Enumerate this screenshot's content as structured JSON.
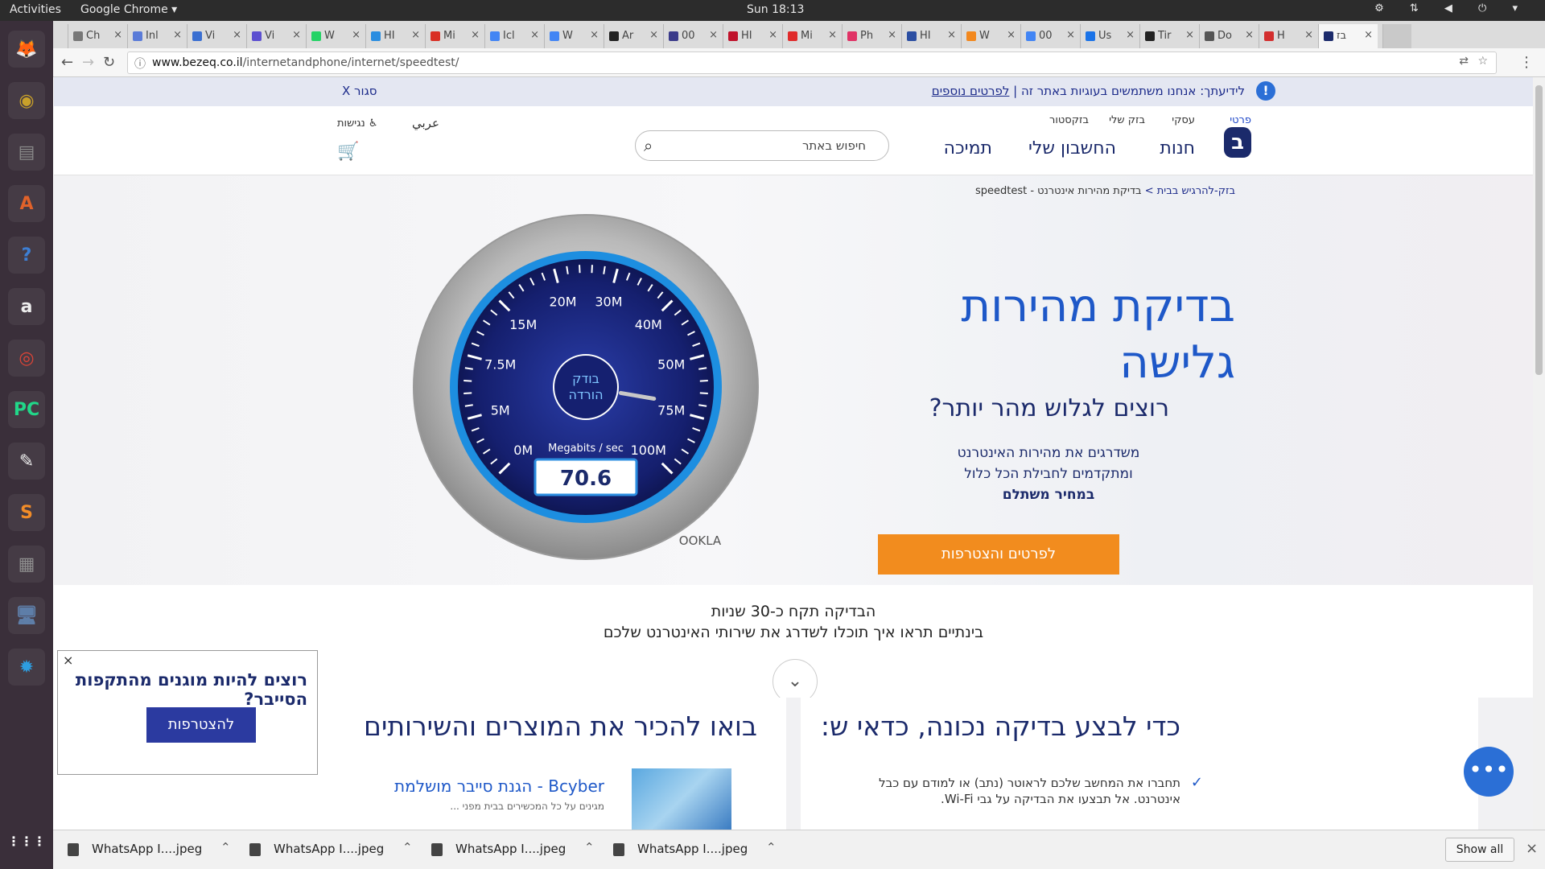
{
  "topbar": {
    "activities": "Activities",
    "app_name": "Google Chrome ▾",
    "clock": "Sun 18:13",
    "tray": "⚙ ⇅ ◀ ⏻ ▾"
  },
  "launcher": {
    "apps": [
      {
        "name": "firefox-icon",
        "glyph": "🦊",
        "color": "#e66000"
      },
      {
        "name": "rhythmbox-icon",
        "glyph": "◉",
        "color": "#c9a12a"
      },
      {
        "name": "files-icon",
        "glyph": "▤",
        "color": "#8a8a8a"
      },
      {
        "name": "software-center-icon",
        "glyph": "A",
        "color": "#e0622a"
      },
      {
        "name": "help-icon",
        "glyph": "?",
        "color": "#3d7fd4"
      },
      {
        "name": "amazon-icon",
        "glyph": "a",
        "color": "#ededed"
      },
      {
        "name": "chrome-icon",
        "glyph": "◎",
        "color": "#db4437"
      },
      {
        "name": "pycharm-icon",
        "glyph": "PC",
        "color": "#21d789"
      },
      {
        "name": "libreoffice-icon",
        "glyph": "✎",
        "color": "#eeeeee"
      },
      {
        "name": "sublime-icon",
        "glyph": "S",
        "color": "#f28c28"
      },
      {
        "name": "calculator-icon",
        "glyph": "▦",
        "color": "#8e8e8e"
      },
      {
        "name": "remote-desktop-icon",
        "glyph": "🖥",
        "color": "#5e7ea8"
      },
      {
        "name": "settings-icon",
        "glyph": "✹",
        "color": "#2d9de0"
      }
    ],
    "grid_glyph": "⋮⋮⋮"
  },
  "tabs": [
    {
      "label": "Ch",
      "favicon": "#777777"
    },
    {
      "label": "Inl",
      "favicon": "#5a7bd8"
    },
    {
      "label": "Vi",
      "favicon": "#3a6fd1"
    },
    {
      "label": "Vi",
      "favicon": "#5c4fd0"
    },
    {
      "label": "W",
      "favicon": "#25d366"
    },
    {
      "label": "HI",
      "favicon": "#2a8de0"
    },
    {
      "label": "Mi",
      "favicon": "#d93025"
    },
    {
      "label": "Icl",
      "favicon": "#4285f4"
    },
    {
      "label": "W",
      "favicon": "#4285f4"
    },
    {
      "label": "Ar",
      "favicon": "#222222"
    },
    {
      "label": "00",
      "favicon": "#3a3a8a"
    },
    {
      "label": "HI",
      "favicon": "#c0122b"
    },
    {
      "label": "Mi",
      "favicon": "#e02a2a"
    },
    {
      "label": "Ph",
      "favicon": "#e03366"
    },
    {
      "label": "HI",
      "favicon": "#2b4ea2"
    },
    {
      "label": "W",
      "favicon": "#f2881e"
    },
    {
      "label": "00",
      "favicon": "#4285f4"
    },
    {
      "label": "Us",
      "favicon": "#1a73e8"
    },
    {
      "label": "Tir",
      "favicon": "#222222"
    },
    {
      "label": "Do",
      "favicon": "#555555"
    },
    {
      "label": "H",
      "favicon": "#d32f2f"
    },
    {
      "label": "בז",
      "favicon": "#1b2a6b"
    }
  ],
  "address": {
    "domain": "www.bezeq.co.il",
    "path": "/internetandphone/internet/speedtest/",
    "back": "←",
    "forward": "→",
    "reload": "↻",
    "lock": "ⓘ",
    "translate": "⇄",
    "star": "☆",
    "menu": "⋮"
  },
  "cookie_bar": {
    "message": "לידיעתך: אנחנו משתמשים בעוגיות באתר זה | ",
    "link": "לפרטים נוספים",
    "close": "סגור X",
    "icon": "!"
  },
  "header": {
    "sections": [
      "פרטי",
      "עסקי",
      "בזק שלי",
      "בזקסטור"
    ],
    "logo": "ב",
    "nav": [
      "חנות",
      "החשבון שלי",
      "תמיכה"
    ],
    "search_placeholder": "חיפוש באתר",
    "search_icon": "⌕",
    "lang_arabic": "عربي",
    "accessibility": "נגישות",
    "cart_icon": "🛒"
  },
  "breadcrumb": {
    "home": "בזק-להרגיש בבית",
    "sep": " > ",
    "current": "בדיקת מהירות אינטרנט - speedtest"
  },
  "gauge": {
    "ticks": [
      "0M",
      "5M",
      "7.5M",
      "15M",
      "20M",
      "30M",
      "40M",
      "50M",
      "75M",
      "100M"
    ],
    "status_line1": "בודק",
    "status_line2": "הורדה",
    "unit_label": "Megabits / sec",
    "value": "70.6",
    "brand": "OOKLA"
  },
  "hero": {
    "title": "בדיקת מהירות גלישה",
    "subtitle": "רוצים לגלוש מהר יותר?",
    "line1": "משדרגים את מהירות האינטרנט",
    "line2": "ומתקדמים לחבילת הכל כלול",
    "line3": "במחיר משתלם",
    "cta": "לפרטים והצטרפות"
  },
  "mid": {
    "line1": "הבדיקה תקח כ-30 שניות",
    "line2": "בינתיים תראו איך תוכלו לשדרג את שירותי האינטרנט שלכם",
    "down_icon": "⌄"
  },
  "lower": {
    "tips_title": "כדי לבצע בדיקה נכונה, כדאי ש:",
    "tip1": "תחברו את המחשב שלכם לראוטר (נתב) או למודם עם כבל אינטרנט. אל תבצעו את הבדיקה על גבי Wi-Fi.",
    "check_icon": "✓",
    "products_title": "בואו להכיר את המוצרים והשירותים",
    "product1": "Bcyber - הגנת סייבר מושלמת",
    "product1_sub": "מגינים על כל המכשירים בבית מפני ..."
  },
  "promo": {
    "close": "×",
    "title": "רוצים להיות מוגנים מהתקפות הסייבר?",
    "button": "להצטרפות"
  },
  "chat_icon": "•••",
  "downloads": {
    "items": [
      "WhatsApp I....jpeg",
      "WhatsApp I....jpeg",
      "WhatsApp I....jpeg",
      "WhatsApp I....jpeg"
    ],
    "chevron": "⌃",
    "show_all": "Show all",
    "close": "×"
  }
}
